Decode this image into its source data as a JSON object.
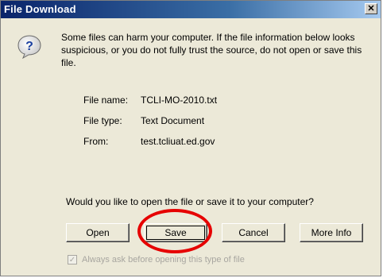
{
  "dialog": {
    "title": "File Download",
    "close_glyph": "✕",
    "icon": "question-icon",
    "warning_text": "Some files can harm your computer. If the file information below looks suspicious, or you do not fully trust the source, do not open or save this file.",
    "file_info": {
      "name_label": "File name:",
      "name_value": "TCLI-MO-2010.txt",
      "type_label": "File type:",
      "type_value": "Text Document",
      "from_label": "From:",
      "from_value": "test.tcliuat.ed.gov"
    },
    "question": "Would you like to open the file or save it to your computer?",
    "buttons": {
      "open": "Open",
      "save": "Save",
      "cancel": "Cancel",
      "more_info": "More Info"
    },
    "checkbox": {
      "label": "Always ask before opening this type of file",
      "checked": true
    },
    "colors": {
      "title_bar": "#0a246a",
      "dialog_bg": "#ece9d8",
      "annotation_ring": "#e60000"
    }
  }
}
